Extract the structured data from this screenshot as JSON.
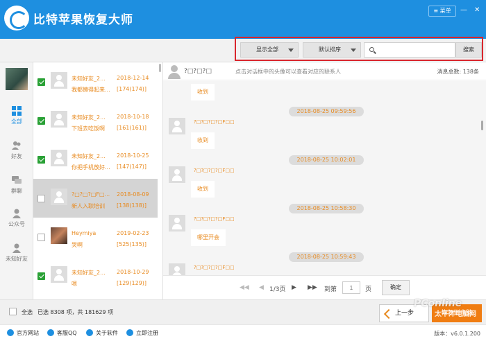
{
  "app": {
    "title": "比特苹果恢复大师",
    "menu_label": "菜单"
  },
  "toolbar": {
    "filter_label": "显示全部",
    "sort_label": "默认排序",
    "search_placeholder": "",
    "search_button": "搜索"
  },
  "nav": {
    "items": [
      {
        "label": "全部",
        "icon": "grid-icon"
      },
      {
        "label": "好友",
        "icon": "friends-icon"
      },
      {
        "label": "群聊",
        "icon": "group-chat-icon"
      },
      {
        "label": "公众号",
        "icon": "official-account-icon"
      },
      {
        "label": "未知好友",
        "icon": "unknown-friend-icon"
      }
    ]
  },
  "contacts": [
    {
      "name": "未知好友_2...",
      "date": "2018-12-14",
      "message": "我都懒得起来...",
      "count": "[174(174)]",
      "checked": true
    },
    {
      "name": "未知好友_2...",
      "date": "2018-10-18",
      "message": "下班去吃饭啊",
      "count": "[161(161)]",
      "checked": true
    },
    {
      "name": "未知好友_2...",
      "date": "2018-10-25",
      "message": "你把手机放好...",
      "count": "[147(147)]",
      "checked": true
    },
    {
      "name": "?□?□?□F□...",
      "date": "2018-08-09",
      "message": "新人入职培训",
      "count": "[138(138)]",
      "checked": false
    },
    {
      "name": "Heymiya",
      "date": "2019-02-23",
      "message": "哭啊",
      "count": "[525(135)]",
      "checked": false
    },
    {
      "name": "未知好友_2...",
      "date": "2018-10-29",
      "message": "嗯",
      "count": "[129(129)]",
      "checked": true
    }
  ],
  "chat": {
    "header_name": "?□?□?□",
    "header_hint": "点击对话框中的头像可以查看对应的联系人",
    "total": "消息总数: 138条",
    "sender": "?□?□?□?□F□□",
    "messages": [
      {
        "text": "收到"
      },
      {
        "time": "2018-08-25 09:59:56",
        "text": "收到"
      },
      {
        "time": "2018-08-25 10:02:01",
        "text": "收到"
      },
      {
        "time": "2018-08-25 10:58:30",
        "text": "哪里开会"
      },
      {
        "time": "2018-08-25 10:59:43",
        "text": ""
      }
    ]
  },
  "pager": {
    "page_info": "1/3页",
    "goto_label": "到第",
    "page_value": "1",
    "page_unit": "页",
    "confirm": "确定"
  },
  "bottom": {
    "select_all": "全选",
    "stats": "已选 8308 项，共 181629 项",
    "prev": "上一步",
    "recover": "恢复到电脑"
  },
  "statusbar": {
    "links": [
      "官方网站",
      "客服QQ",
      "关于软件",
      "立即注册"
    ],
    "version": "版本：v6.0.1.200"
  },
  "watermark": {
    "brand": "PConline",
    "sub": "太平洋电脑网"
  },
  "colors": {
    "primary": "#1e8fe0",
    "accent": "#e88a1f",
    "highlight": "#d9262d",
    "recover": "#f07d12"
  }
}
